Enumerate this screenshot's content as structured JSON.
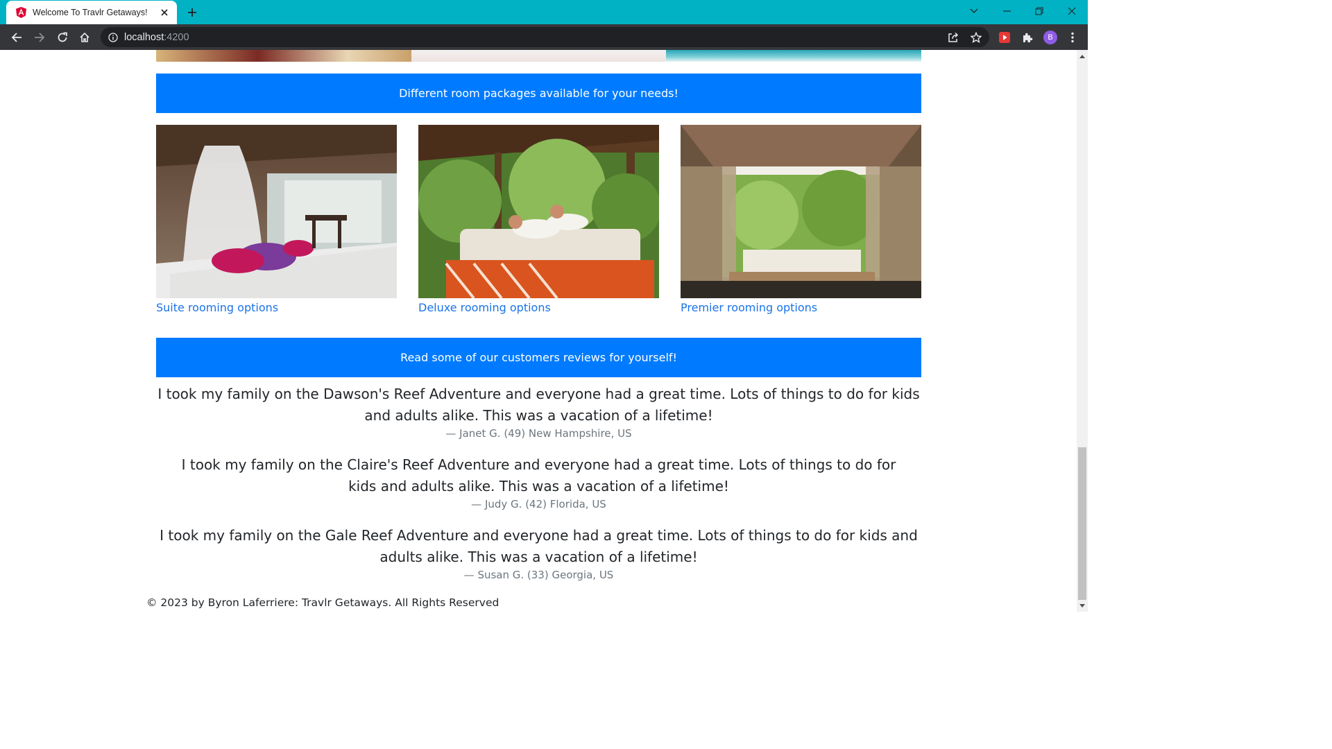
{
  "browser": {
    "tab_title": "Welcome To Travlr Getaways!",
    "url_host": "localhost",
    "url_port": ":4200",
    "profile_initial": "B"
  },
  "rooms": {
    "banner": "Different room packages available for your needs!",
    "cards": [
      {
        "label": "Suite rooming options"
      },
      {
        "label": "Deluxe rooming options"
      },
      {
        "label": "Premier rooming options"
      }
    ]
  },
  "reviews": {
    "banner": "Read some of our customers reviews for yourself!",
    "items": [
      {
        "quote": "I took my family on the Dawson's Reef Adventure and everyone had a great time. Lots of things to do for kids and adults alike. This was a vacation of a lifetime!",
        "author": "— Janet G. (49) New Hampshire, US"
      },
      {
        "quote": "I took my family on the Claire's Reef Adventure and everyone had a great time. Lots of things to do for kids and adults alike. This was a vacation of a lifetime!",
        "author": "— Judy G. (42) Florida, US"
      },
      {
        "quote": "I took my family on the Gale Reef Adventure and everyone had a great time. Lots of things to do for kids and adults alike. This was a vacation of a lifetime!",
        "author": "— Susan G. (33) Georgia, US"
      }
    ]
  },
  "footer": {
    "text": "© 2023 by Byron Laferriere: Travlr Getaways. All Rights Reserved"
  }
}
